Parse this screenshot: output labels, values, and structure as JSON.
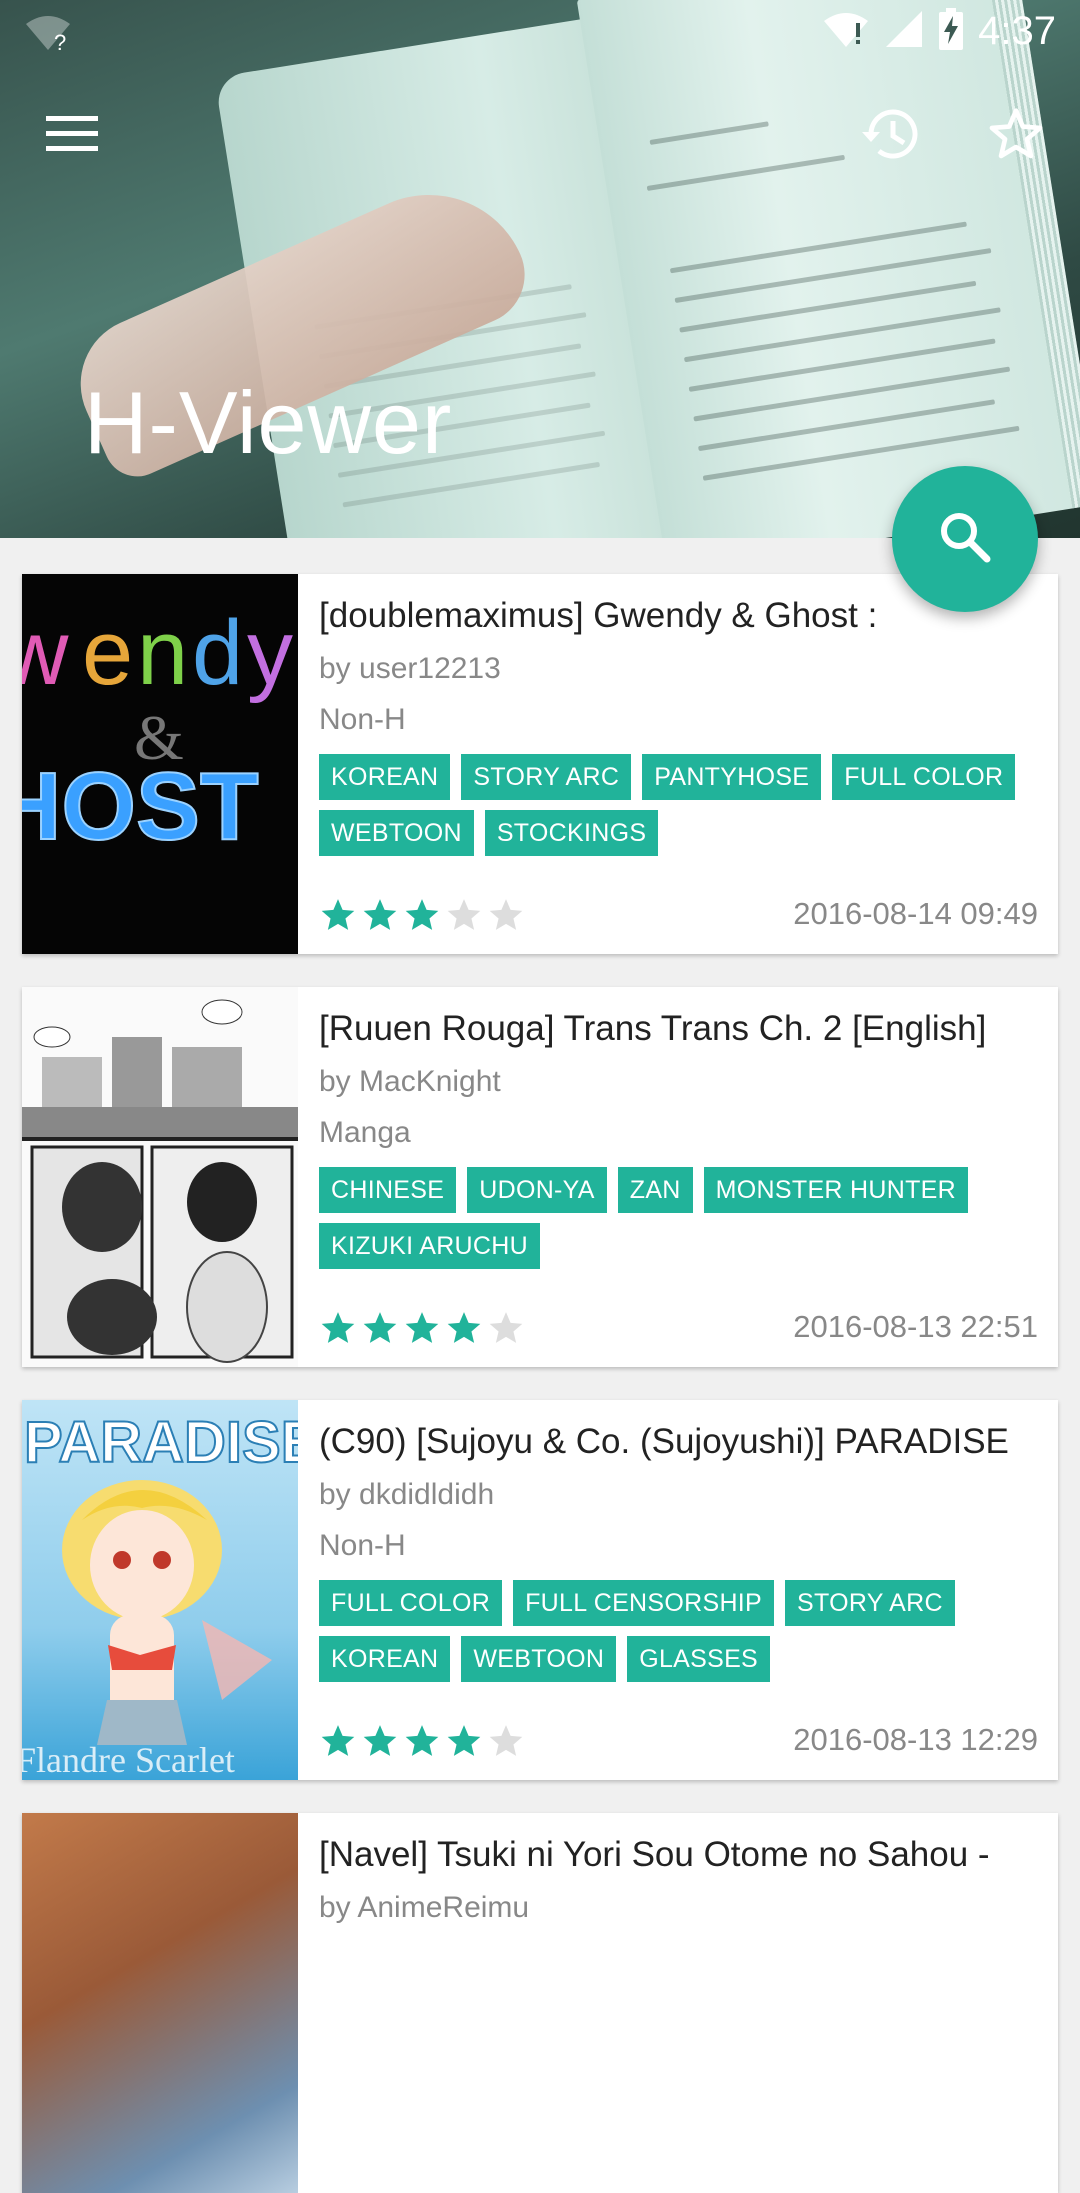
{
  "app": {
    "title": "H-Viewer"
  },
  "status_bar": {
    "time": "4:37"
  },
  "icons": {
    "menu": "menu-icon",
    "history": "history-icon",
    "favorite": "star-outline-icon",
    "search": "search-icon"
  },
  "colors": {
    "accent": "#21b39a",
    "star_empty": "#dddddd"
  },
  "galleries": [
    {
      "title": "[doublemaximus] Gwendy & Ghost :",
      "uploader": "by user12213",
      "category": "Non-H",
      "tags": [
        "KOREAN",
        "STORY ARC",
        "PANTYHOSE",
        "FULL COLOR",
        "WEBTOON",
        "STOCKINGS"
      ],
      "rating": 3,
      "date": "2016-08-14 09:49"
    },
    {
      "title": "[Ruuen Rouga] Trans Trans Ch. 2 [English]",
      "uploader": "by MacKnight",
      "category": "Manga",
      "tags": [
        "CHINESE",
        "UDON-YA",
        "ZAN",
        "MONSTER HUNTER",
        "KIZUKI ARUCHU"
      ],
      "rating": 4,
      "date": "2016-08-13 22:51"
    },
    {
      "title": "(C90) [Sujoyu & Co. (Sujoyushi)] PARADISE",
      "uploader": "by dkdidldidh",
      "category": "Non-H",
      "tags": [
        "FULL COLOR",
        "FULL CENSORSHIP",
        "STORY ARC",
        "KOREAN",
        "WEBTOON",
        "GLASSES"
      ],
      "rating": 4,
      "date": "2016-08-13 12:29"
    },
    {
      "title": "[Navel] Tsuki ni Yori Sou Otome no Sahou -",
      "uploader": "by AnimeReimu",
      "category": "",
      "tags": [],
      "rating": 0,
      "date": ""
    }
  ]
}
